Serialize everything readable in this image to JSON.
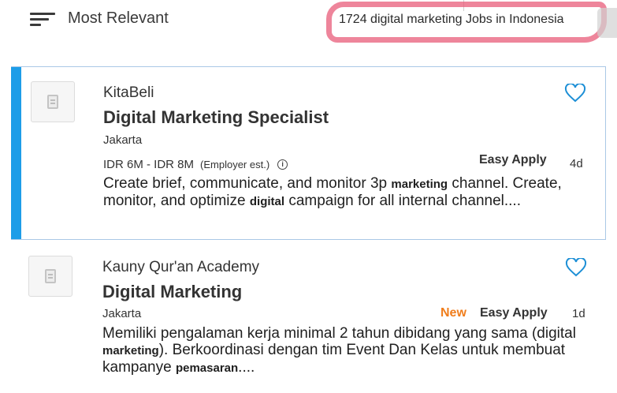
{
  "header": {
    "sort_label": "Most Relevant",
    "sort_icon": "sort-icon",
    "results_count": "1724 digital marketing Jobs in Indonesia",
    "highlight_color": "#e85c7a"
  },
  "accent_color": "#1d9de8",
  "jobs": [
    {
      "company": "KitaBeli",
      "title": "Digital Marketing Specialist",
      "location": "Jakarta",
      "salary": "IDR 6M - IDR 8M",
      "salary_note": "(Employer est.)",
      "badge_new": "",
      "easy_apply": "Easy Apply",
      "age": "4d",
      "desc_parts": [
        "Create brief, communicate, and monitor 3p ",
        "marketing",
        " channel. Create, monitor, and optimize ",
        "digital",
        " campaign for all internal channel...."
      ],
      "selected": true
    },
    {
      "company": "Kauny Qur'an Academy",
      "title": "Digital Marketing",
      "location": "Jakarta",
      "salary": "",
      "salary_note": "",
      "badge_new": "New",
      "easy_apply": "Easy Apply",
      "age": "1d",
      "desc_parts": [
        "Memiliki pengalaman kerja minimal 2 tahun dibidang yang sama (digital ",
        "marketing",
        "). Berkoordinasi dengan tim Event Dan Kelas untuk membuat kampanye ",
        "pemasaran",
        "...."
      ],
      "selected": false
    }
  ]
}
